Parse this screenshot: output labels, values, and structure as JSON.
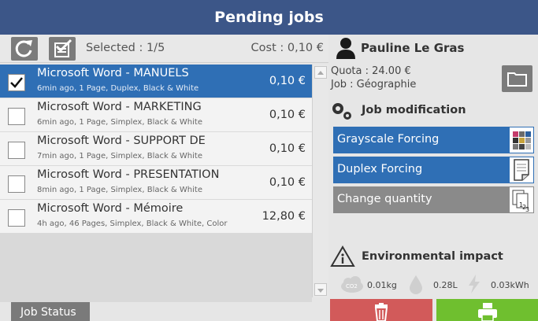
{
  "window": {
    "title": "Pending jobs"
  },
  "toolbar": {
    "selected_text": "Selected : 1/5",
    "cost_text": "Cost : 0,10 €"
  },
  "user": {
    "name": "Pauline Le Gras"
  },
  "jobs": [
    {
      "name": "Microsoft Word - MANUELS",
      "meta": "6min ago, 1 Page, Duplex, Black & White",
      "price": "0,10 €",
      "checked": true
    },
    {
      "name": "Microsoft Word - MARKETING",
      "meta": "6min ago, 1 Page, Simplex, Black & White",
      "price": "0,10 €",
      "checked": false
    },
    {
      "name": "Microsoft Word - SUPPORT DE",
      "meta": "7min ago, 1 Page, Simplex, Black & White",
      "price": "0,10 €",
      "checked": false
    },
    {
      "name": "Microsoft Word - PRESENTATION",
      "meta": "8min ago, 1 Page, Simplex, Black & White",
      "price": "0,10 €",
      "checked": false
    },
    {
      "name": "Microsoft Word - Mémoire",
      "meta": "4h ago, 46 Pages, Simplex, Black & White, Color",
      "price": "12,80 €",
      "checked": false
    }
  ],
  "footer": {
    "job_status_label": "Job Status"
  },
  "account": {
    "quota": "Quota : 24.00 €",
    "job": "Job : Géographie"
  },
  "modification": {
    "title": "Job modification",
    "actions": [
      {
        "label": "Grayscale Forcing",
        "active": true,
        "icon": "color-palette-icon"
      },
      {
        "label": "Duplex Forcing",
        "active": true,
        "icon": "page-fold-icon"
      },
      {
        "label": "Change quantity",
        "active": false,
        "icon": "copies-icon"
      }
    ]
  },
  "environment": {
    "title": "Environmental impact",
    "co2": "0.01kg",
    "water": "0.28L",
    "energy": "0.03kWh",
    "co2_badge": "CO2"
  },
  "colors": {
    "title_bar": "#3c5688",
    "selection": "#2f6fb5",
    "delete": "#d25a5a",
    "print": "#6fbf2f",
    "button_gray": "#7b7b7b"
  }
}
